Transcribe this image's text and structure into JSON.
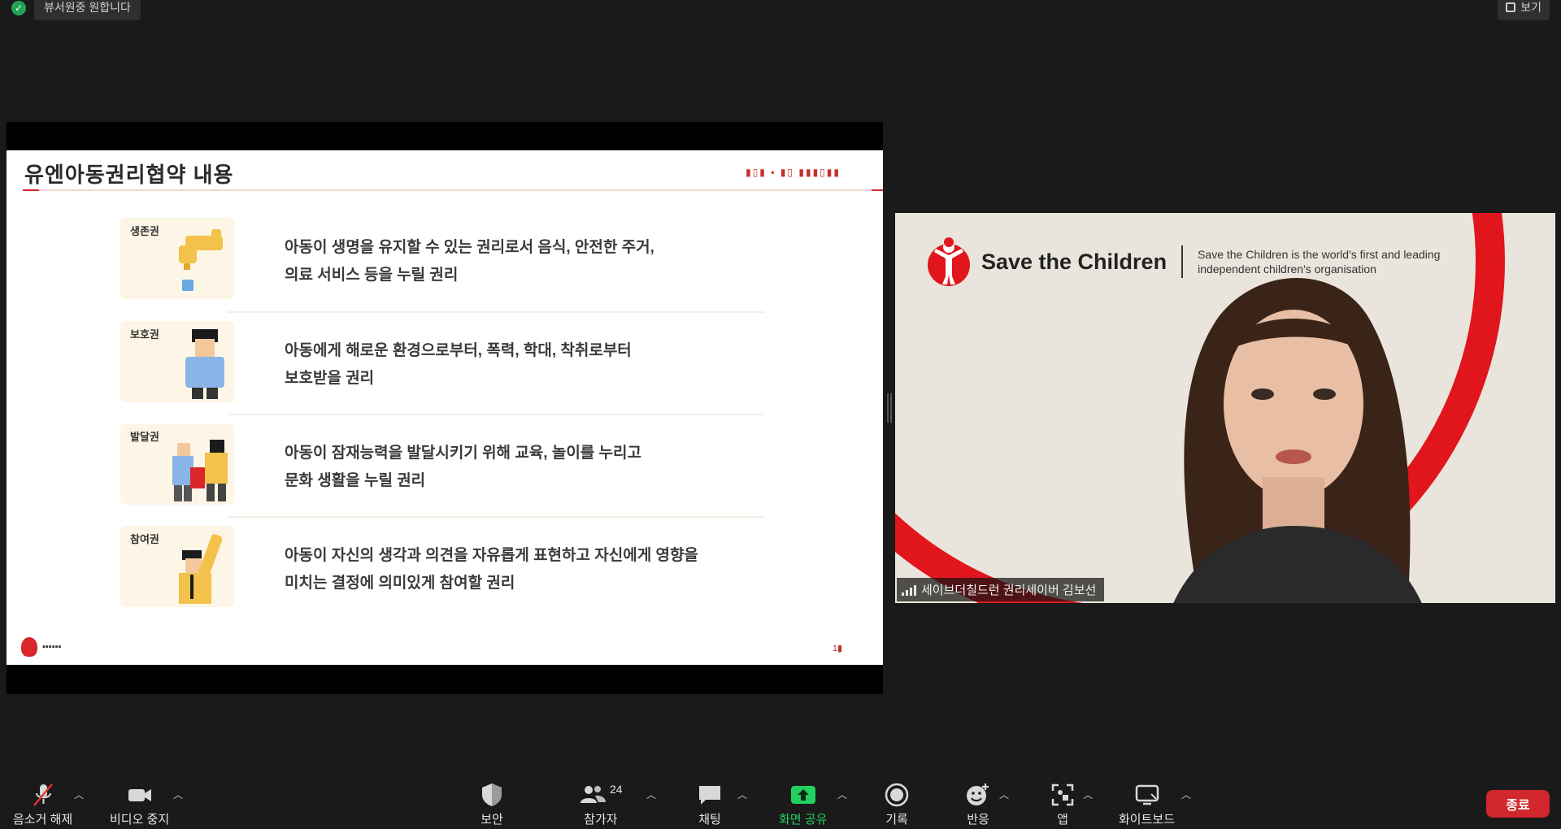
{
  "top": {
    "view_pill": "뷰서원중 원합니다",
    "view_button": "보기"
  },
  "slide": {
    "title": "유엔아동권리협약 내용",
    "top_right": "▮▯▮ ▪ ▮▯ ▮▮▮▯▮▮",
    "rows": [
      {
        "tag": "생존권",
        "text1": "아동이 생명을 유지할 수 있는 권리로서 음식, 안전한 주거,",
        "text2": "의료 서비스 등을 누릴 권리"
      },
      {
        "tag": "보호권",
        "text1": "아동에게 해로운 환경으로부터, 폭력, 학대, 착취로부터",
        "text2": "보호받을 권리"
      },
      {
        "tag": "발달권",
        "text1": "아동이 잠재능력을 발달시키기 위해 교육, 놀이를 누리고",
        "text2": "문화 생활을 누릴 권리"
      },
      {
        "tag": "참여권",
        "text1": "아동이 자신의 생각과 의견을 자유롭게 표현하고 자신에게 영향을",
        "text2": "미치는 결정에 의미있게 참여할 권리"
      }
    ],
    "footer_text": "▪▪▪▪▪▪",
    "page": "1▮"
  },
  "video": {
    "brand": "Save the Children",
    "tagline": "Save the Children is the world's first and leading independent children's organisation",
    "participant_name": "세이브더칠드런 권리세이버 김보선"
  },
  "toolbar": {
    "mute": "음소거 해제",
    "video": "비디오 중지",
    "security": "보안",
    "participants": "참가자",
    "participants_count": "24",
    "chat": "채팅",
    "share": "화면 공유",
    "record": "기록",
    "reactions": "반응",
    "apps": "앱",
    "whiteboard": "화이트보드",
    "end": "종료"
  },
  "colors": {
    "background": "#1a1a1a",
    "share_green": "#23d160",
    "end_red": "#d1272d",
    "stc_red": "#e1151c"
  }
}
